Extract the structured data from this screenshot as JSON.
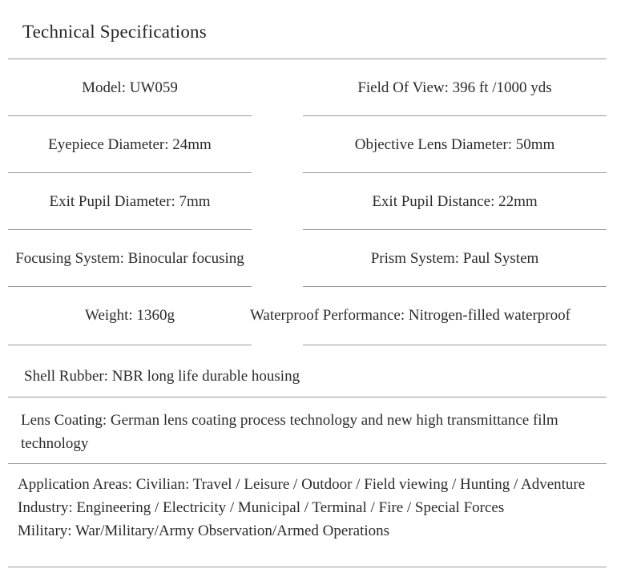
{
  "document": {
    "title": "Technical Specifications",
    "accent_rule_color": "#9a9a9a",
    "text_color": "#2b2b2b",
    "background_color": "#ffffff"
  },
  "specs": {
    "rows": [
      {
        "left": "Model: UW059",
        "right": "Field Of View: 396 ft /1000 yds"
      },
      {
        "left": "Eyepiece Diameter: 24mm",
        "right": "Objective Lens Diameter: 50mm"
      },
      {
        "left": "Exit Pupil Diameter: 7mm",
        "right": "Exit Pupil Distance: 22mm"
      },
      {
        "left": "Focusing System: Binocular focusing",
        "right": "Prism System: Paul System"
      },
      {
        "left": "Weight: 1360g",
        "right": "Waterproof Performance: Nitrogen-filled waterproof"
      }
    ],
    "shell_rubber": "Shell Rubber: NBR long life durable housing",
    "lens_coating": "Lens Coating: German lens coating process technology and new high transmittance film technology",
    "application_areas": [
      "Application Areas: Civilian: Travel / Leisure / Outdoor / Field viewing / Hunting / Adventure",
      "Industry: Engineering / Electricity / Municipal / Terminal / Fire / Special Forces",
      "Military: War/Military/Army Observation/Armed Operations"
    ]
  }
}
